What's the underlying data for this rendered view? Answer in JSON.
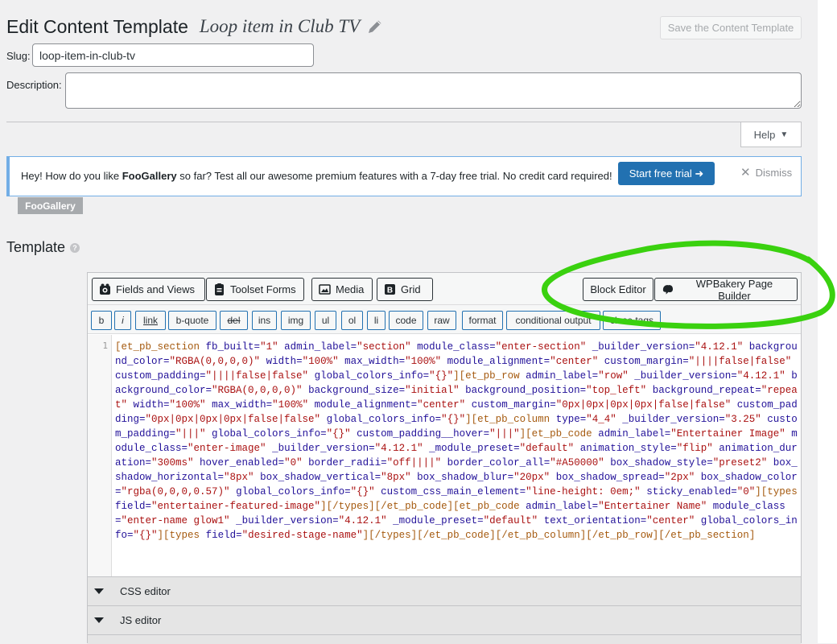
{
  "header": {
    "title": "Edit Content Template",
    "template_name": "Loop item in Club TV",
    "save_label": "Save the Content Template"
  },
  "slug": {
    "label": "Slug:",
    "value": "loop-item-in-club-tv"
  },
  "description": {
    "label": "Description:",
    "value": ""
  },
  "help": {
    "label": "Help"
  },
  "notice": {
    "prefix": "Hey! How do you like ",
    "brand": "FooGallery",
    "suffix": " so far? Test all our awesome premium features with a 7-day free trial. No credit card required!",
    "button_label": "Start free trial ➜",
    "dismiss_label": "Dismiss",
    "badge": "FooGallery"
  },
  "template_section": {
    "heading": "Template"
  },
  "toolbar": {
    "fields_and_views": "Fields and Views",
    "toolset_forms": "Toolset Forms",
    "media": "Media",
    "grid": "Grid",
    "block_editor": "Block Editor",
    "wpbakery": "WPBakery Page Builder"
  },
  "quicktags": [
    "b",
    "i",
    "link",
    "b-quote",
    "del",
    "ins",
    "img",
    "ul",
    "ol",
    "li",
    "code",
    "raw",
    "format",
    "conditional output",
    "close tags"
  ],
  "code": {
    "line_number": "1",
    "text": "[et_pb_section fb_built=\"1\" admin_label=\"section\" module_class=\"enter-section\" _builder_version=\"4.12.1\" background_color=\"RGBA(0,0,0,0)\" width=\"100%\" max_width=\"100%\" module_alignment=\"center\" custom_margin=\"||||false|false\" custom_padding=\"||||false|false\" global_colors_info=\"{}\"][et_pb_row admin_label=\"row\" _builder_version=\"4.12.1\" background_color=\"RGBA(0,0,0,0)\" background_size=\"initial\" background_position=\"top_left\" background_repeat=\"repeat\" width=\"100%\" max_width=\"100%\" module_alignment=\"center\" custom_margin=\"0px|0px|0px|0px|false|false\" custom_padding=\"0px|0px|0px|0px|false|false\" global_colors_info=\"{}\"][et_pb_column type=\"4_4\" _builder_version=\"3.25\" custom_padding=\"|||\" global_colors_info=\"{}\" custom_padding__hover=\"|||\"][et_pb_code admin_label=\"Entertainer Image\" module_class=\"enter-image\" _builder_version=\"4.12.1\" _module_preset=\"default\" animation_style=\"flip\" animation_duration=\"300ms\" hover_enabled=\"0\" border_radii=\"off||||\" border_color_all=\"#A50000\" box_shadow_style=\"preset2\" box_shadow_horizontal=\"8px\" box_shadow_vertical=\"8px\" box_shadow_blur=\"20px\" box_shadow_spread=\"2px\" box_shadow_color=\"rgba(0,0,0,0.57)\" global_colors_info=\"{}\" custom_css_main_element=\"line-height: 0em;\" sticky_enabled=\"0\"][types field=\"entertainer-featured-image\"][/types][/et_pb_code][et_pb_code admin_label=\"Entertainer Name\" module_class=\"enter-name glow1\" _builder_version=\"4.12.1\" _module_preset=\"default\" text_orientation=\"center\" global_colors_info=\"{}\"][types field=\"desired-stage-name\"][/types][/et_pb_code][/et_pb_column][/et_pb_row][/et_pb_section]"
  },
  "panels": {
    "css_editor": "CSS editor",
    "js_editor": "JS editor"
  },
  "colors": {
    "primary": "#2271b1",
    "annotation": "#3ad10f"
  }
}
